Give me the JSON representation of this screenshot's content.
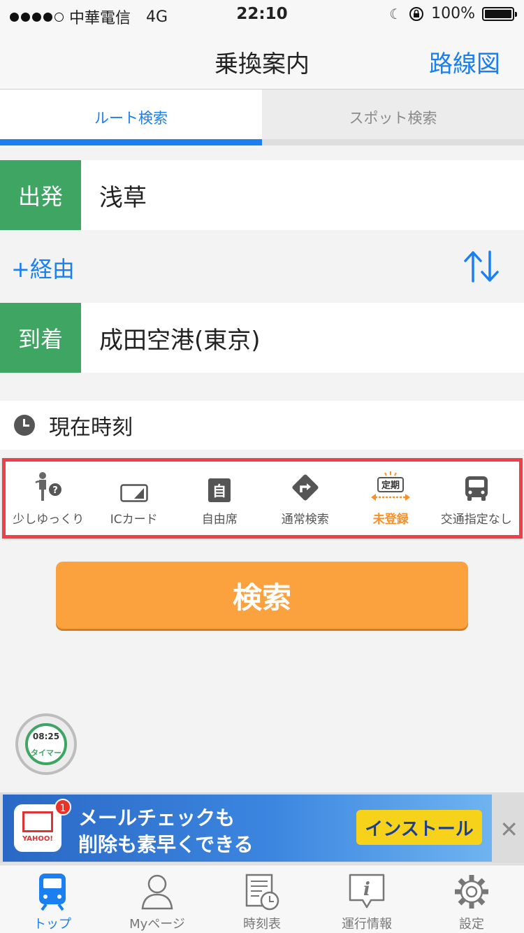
{
  "status_bar": {
    "carrier": "中華電信",
    "network": "4G",
    "time": "22:10",
    "battery": "100%"
  },
  "nav": {
    "title": "乗換案内",
    "right_link": "路線図"
  },
  "tabs": [
    {
      "label": "ルート検索",
      "active": true
    },
    {
      "label": "スポット検索",
      "active": false
    }
  ],
  "departure": {
    "label": "出発",
    "value": "浅草"
  },
  "via": {
    "label": "+経由"
  },
  "arrival": {
    "label": "到着",
    "value": "成田空港(東京)"
  },
  "time_setting": {
    "label": "現在時刻"
  },
  "options": [
    {
      "label": "少しゆっくり",
      "icon": "walking-speed-icon"
    },
    {
      "label": "ICカード",
      "icon": "ic-card-icon"
    },
    {
      "label": "自由席",
      "icon": "seat-icon"
    },
    {
      "label": "通常検索",
      "icon": "route-sign-icon"
    },
    {
      "label": "未登録",
      "icon": "commuter-pass-icon",
      "icon_text": "定期"
    },
    {
      "label": "交通指定なし",
      "icon": "bus-icon"
    }
  ],
  "search_button": {
    "label": "検索"
  },
  "timer": {
    "time": "08:25",
    "label": "タイマー"
  },
  "ad": {
    "badge": "1",
    "logo_text": "YAHOO!",
    "line1": "メールチェックも",
    "line2": "削除も素早くできる",
    "cta": "インストール",
    "close": "✕"
  },
  "tab_bar": [
    {
      "label": "トップ",
      "icon": "train-icon",
      "active": true
    },
    {
      "label": "Myページ",
      "icon": "person-icon",
      "active": false
    },
    {
      "label": "時刻表",
      "icon": "timetable-icon",
      "active": false
    },
    {
      "label": "運行情報",
      "icon": "info-icon",
      "active": false
    },
    {
      "label": "設定",
      "icon": "gear-icon",
      "active": false
    }
  ],
  "colors": {
    "accent_blue": "#1a7ff0",
    "station_green": "#3fa563",
    "search_orange": "#fba13d",
    "highlight_red": "#ee4048",
    "option_highlight": "#f5922a"
  }
}
